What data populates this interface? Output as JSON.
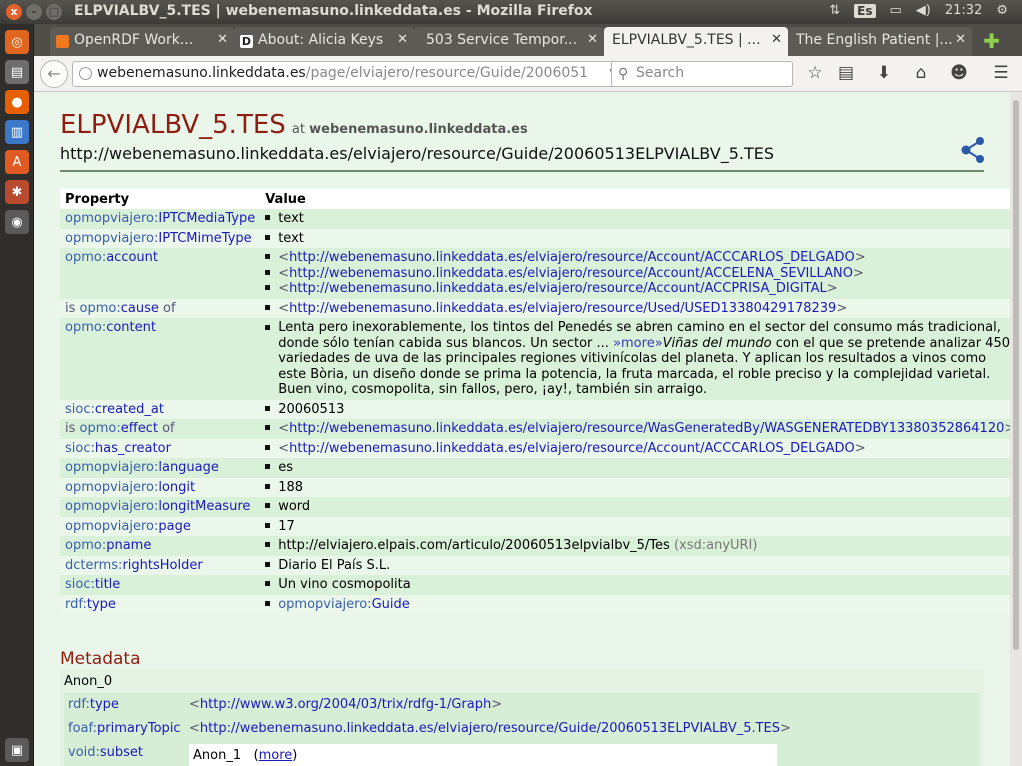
{
  "window": {
    "title": "ELPVIALBV_5.TES | webenemasuno.linkeddata.es - Mozilla Firefox",
    "controls": [
      "x",
      "–",
      "□"
    ]
  },
  "indicators": {
    "input_method": "Es",
    "clock": "21:32"
  },
  "tabs": [
    {
      "label": "OpenRDF Work...",
      "favicon_color": "#f0781e",
      "active": false
    },
    {
      "label": "About: Alicia Keys",
      "favicon_color": "#222222",
      "favicon_letter": "D",
      "active": false
    },
    {
      "label": "503 Service Tempor...",
      "favicon_color": "",
      "active": false
    },
    {
      "label": "ELPVIALBV_5.TES | ...",
      "favicon_color": "",
      "active": true
    },
    {
      "label": "The English Patient |...",
      "favicon_color": "",
      "active": false
    }
  ],
  "toolbar": {
    "url_host": "webenemasuno.linkeddata.es",
    "url_path": "/page/elviajero/resource/Guide/2006051",
    "search_placeholder": "Search"
  },
  "page": {
    "title": "ELPVIALBV_5.TES",
    "at_label": "at",
    "host": "webenemasuno.linkeddata.es",
    "uri": "http://webenemasuno.linkeddata.es/elviajero/resource/Guide/20060513ELPVIALBV_5.TES"
  },
  "table": {
    "header_property": "Property",
    "header_value": "Value",
    "rows": [
      {
        "prefix": "opmopviajero:",
        "local": "IPTCMediaType",
        "values": [
          "text"
        ]
      },
      {
        "prefix": "opmopviajero:",
        "local": "IPTCMimeType",
        "values": [
          "text"
        ]
      },
      {
        "prefix": "opmo:",
        "local": "account",
        "link_values": [
          "http://webenemasuno.linkeddata.es/elviajero/resource/Account/ACCCARLOS_DELGADO",
          "http://webenemasuno.linkeddata.es/elviajero/resource/Account/ACCELENA_SEVILLANO",
          "http://webenemasuno.linkeddata.es/elviajero/resource/Account/ACCPRISA_DIGITAL"
        ]
      },
      {
        "pre": "is ",
        "prefix": "opmo:",
        "local": "cause",
        "post": " of",
        "link_values": [
          "http://webenemasuno.linkeddata.es/elviajero/resource/Used/USED13380429178239"
        ]
      },
      {
        "prefix": "opmo:",
        "local": "content",
        "text_a": "Lenta pero inexorablemente, los tintos del Penedés se abren camino en el sector del consumo más tradicional, donde sólo tenían cabida sus blancos. Un sector ... ",
        "more": "»more»",
        "text_italic": "Viñas del mundo",
        "text_b": " con el que se pretende analizar 450 variedades de uva de las principales regiones vitivinícolas del planeta. Y aplican los resultados a vinos como este Bòria, un diseño donde se prima la potencia, la fruta marcada, el roble preciso y la complejidad varietal. Buen vino, cosmopolita, sin fallos, pero, ¡ay!, también sin arraigo."
      },
      {
        "prefix": "sioc:",
        "local": "created_at",
        "values": [
          "20060513"
        ]
      },
      {
        "pre": "is ",
        "prefix": "opmo:",
        "local": "effect",
        "post": " of",
        "link_values": [
          "http://webenemasuno.linkeddata.es/elviajero/resource/WasGeneratedBy/WASGENERATEDBY13380352864120"
        ]
      },
      {
        "prefix": "sioc:",
        "local": "has_creator",
        "link_values": [
          "http://webenemasuno.linkeddata.es/elviajero/resource/Account/ACCCARLOS_DELGADO"
        ]
      },
      {
        "prefix": "opmopviajero:",
        "local": "language",
        "values": [
          "es"
        ]
      },
      {
        "prefix": "opmopviajero:",
        "local": "longit",
        "values": [
          "188"
        ]
      },
      {
        "prefix": "opmopviajero:",
        "local": "longitMeasure",
        "values": [
          "word"
        ]
      },
      {
        "prefix": "opmopviajero:",
        "local": "page",
        "values": [
          "17"
        ]
      },
      {
        "prefix": "opmo:",
        "local": "pname",
        "values": [
          "http://elviajero.elpais.com/articulo/20060513elpvialbv_5/Tes"
        ],
        "datatype": "(xsd:anyURI)"
      },
      {
        "prefix": "dcterms:",
        "local": "rightsHolder",
        "values": [
          "Diario El País S.L."
        ]
      },
      {
        "prefix": "sioc:",
        "local": "title",
        "values": [
          "Un vino cosmopolita"
        ]
      },
      {
        "prefix": "rdf:",
        "local": "type",
        "qname_values": [
          {
            "prefix": "opmopviajero:",
            "local": "Guide"
          }
        ]
      }
    ]
  },
  "metadata": {
    "heading": "Metadata",
    "graph": "Anon_0",
    "rows": [
      {
        "prefix": "rdf:",
        "local": "type",
        "value": "http://www.w3.org/2004/03/trix/rdfg-1/Graph"
      },
      {
        "prefix": "foaf:",
        "local": "primaryTopic",
        "value": "http://webenemasuno.linkeddata.es/elviajero/resource/Guide/20060513ELPVIALBV_5.TES"
      },
      {
        "prefix": "void:",
        "local": "subset",
        "value": "Anon_1",
        "more": "more"
      }
    ]
  }
}
